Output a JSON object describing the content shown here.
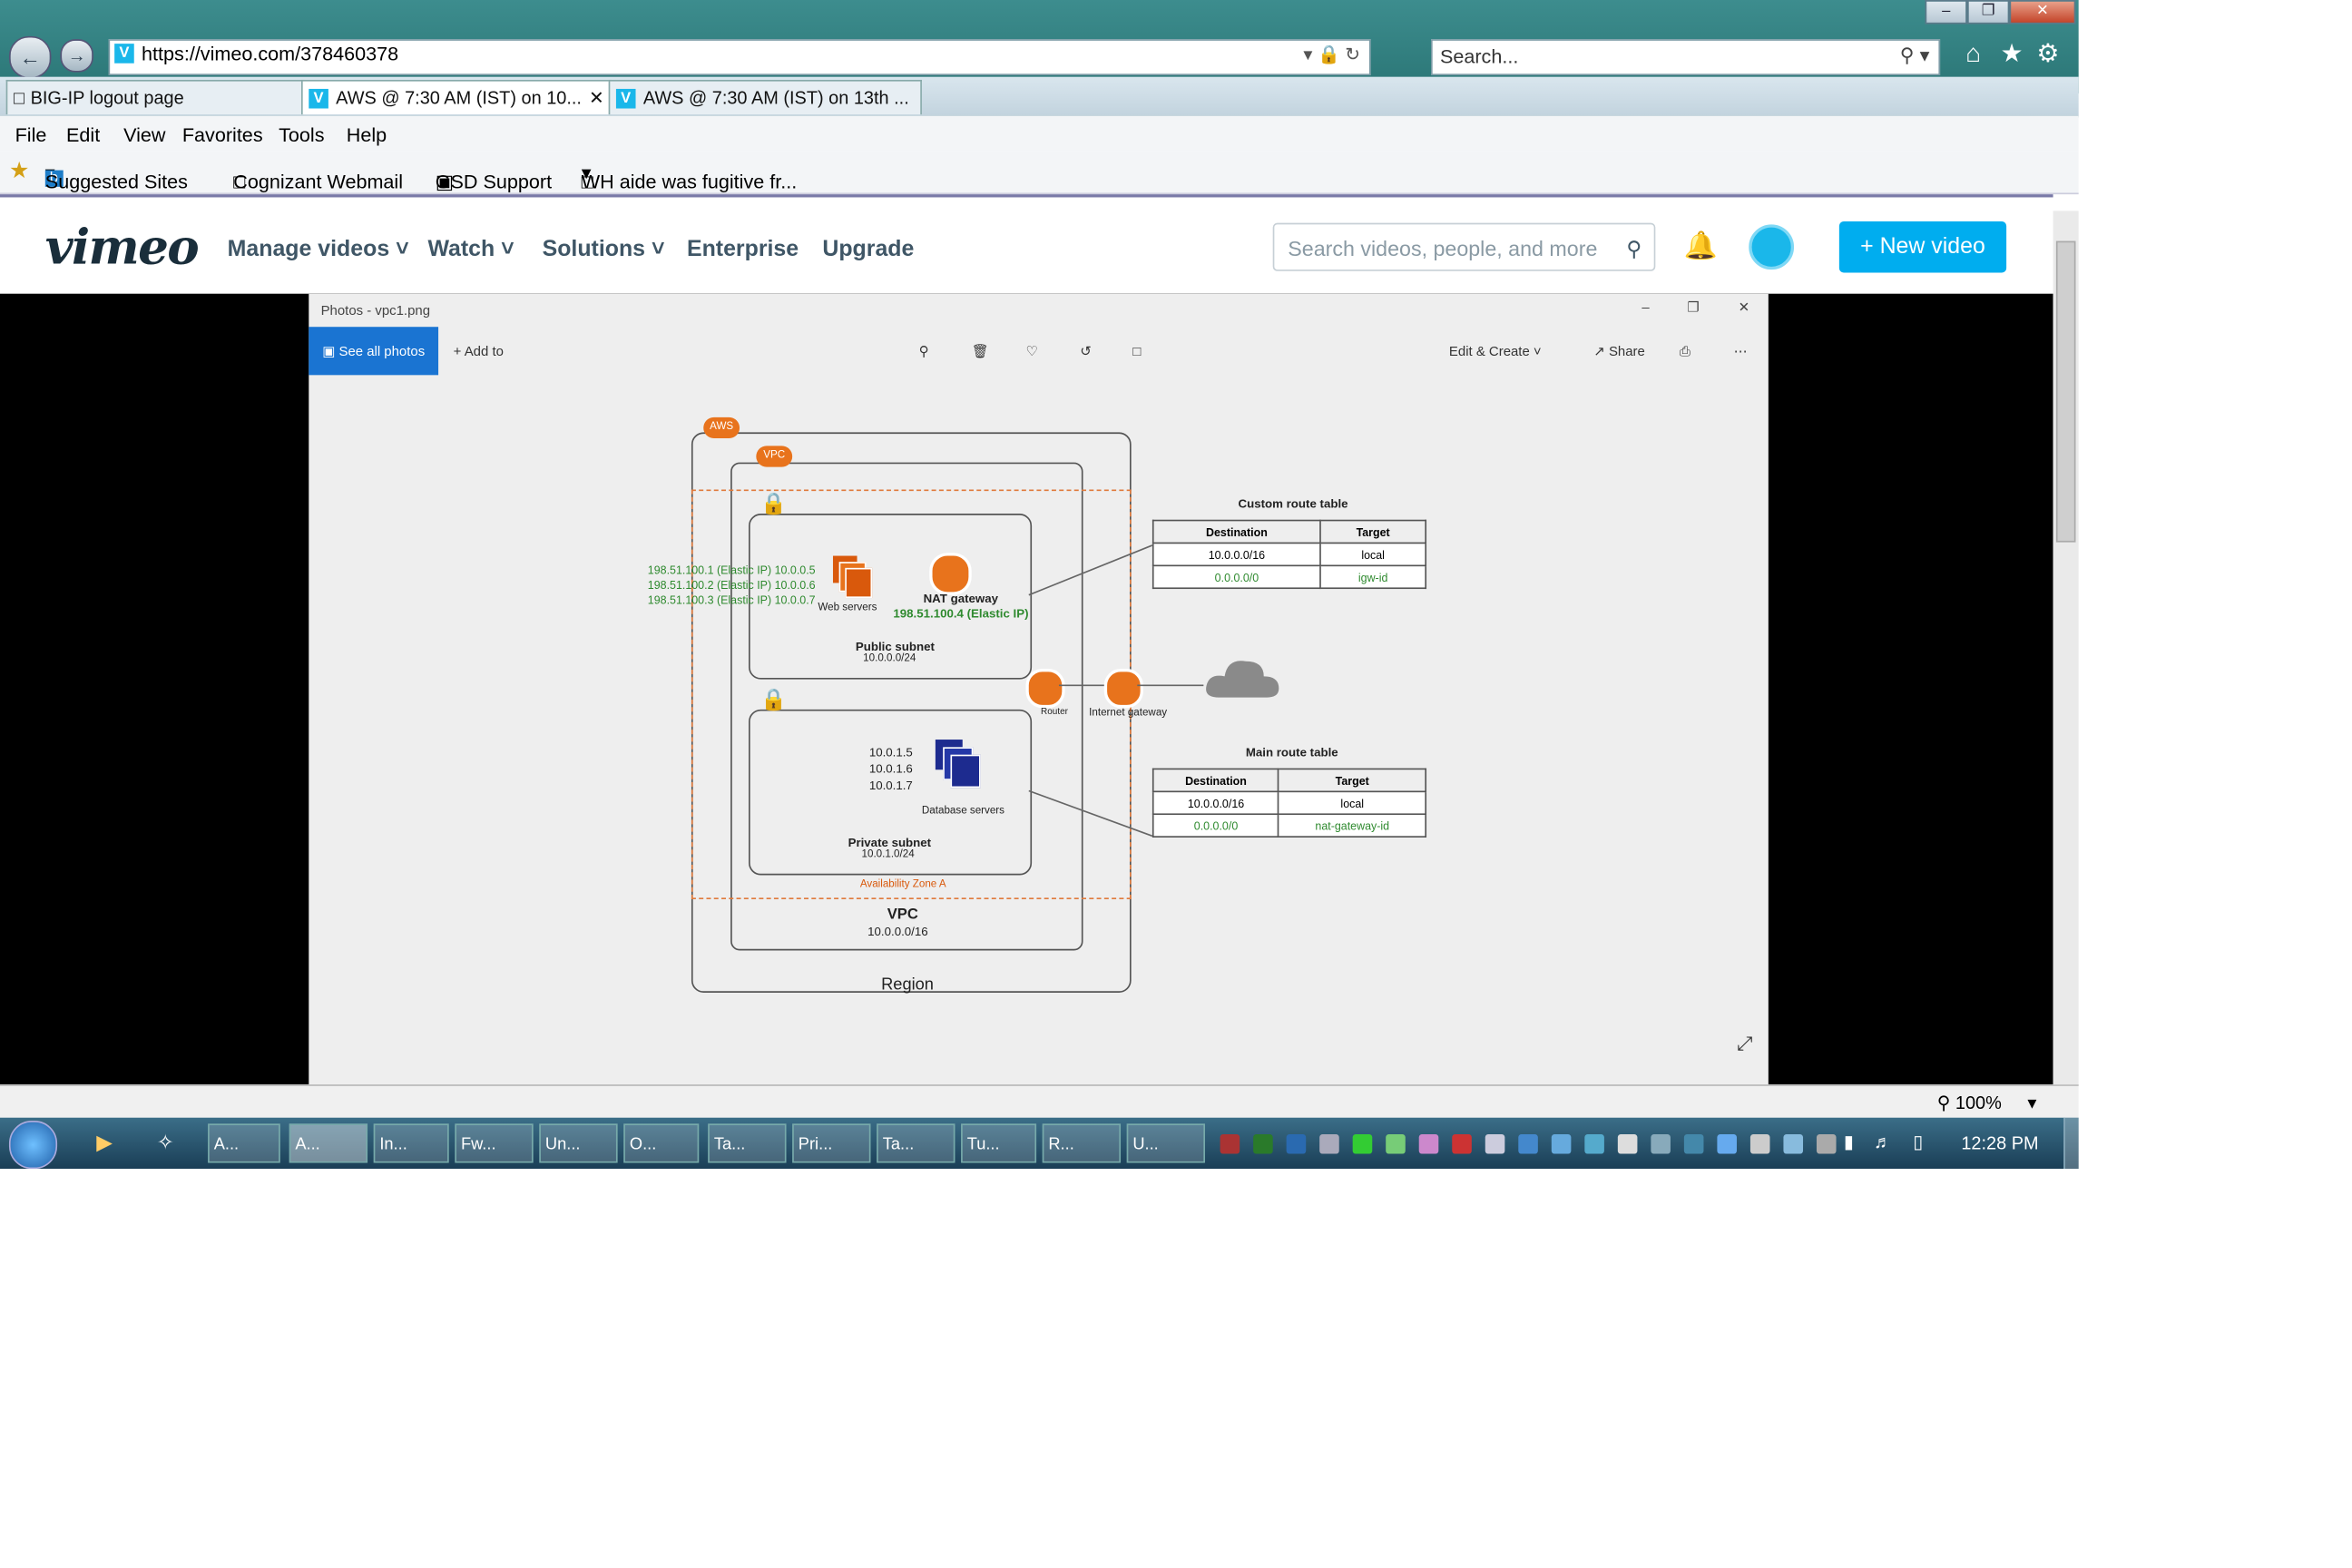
{
  "browser": {
    "url": "https://vimeo.com/378460378",
    "search_placeholder": "Search...",
    "tabs": [
      {
        "label": "BIG-IP logout page"
      },
      {
        "label": "AWS @ 7:30 AM (IST) on 10..."
      },
      {
        "label": "AWS @ 7:30 AM (IST) on 13th ..."
      }
    ],
    "menu": [
      "File",
      "Edit",
      "View",
      "Favorites",
      "Tools",
      "Help"
    ],
    "favorites": [
      "Suggested Sites",
      "Cognizant Webmail",
      "GSD Support",
      "WH aide was fugitive fr..."
    ],
    "zoom": "100%"
  },
  "vimeo": {
    "logo": "vimeo",
    "nav": [
      "Manage videos",
      "Watch",
      "Solutions",
      "Enterprise",
      "Upgrade"
    ],
    "search_placeholder": "Search videos, people, and more",
    "new_video": "New video"
  },
  "photos_app": {
    "title": "Photos - vpc1.png",
    "see_all": "See all photos",
    "add_to": "Add to",
    "edit_create": "Edit & Create",
    "share": "Share"
  },
  "diagram": {
    "aws_badge": "AWS",
    "vpc_badge": "VPC",
    "elastic_ips": [
      "198.51.100.1 (Elastic IP) 10.0.0.5",
      "198.51.100.2 (Elastic IP) 10.0.0.6",
      "198.51.100.3 (Elastic IP) 10.0.0.7"
    ],
    "web_servers": "Web servers",
    "nat_gateway": "NAT gateway",
    "nat_ip": "198.51.100.4 (Elastic IP)",
    "public_subnet": "Public subnet",
    "public_cidr": "10.0.0.0/24",
    "db_ips": [
      "10.0.1.5",
      "10.0.1.6",
      "10.0.1.7"
    ],
    "database_servers": "Database servers",
    "private_subnet": "Private  subnet",
    "private_cidr": "10.0.1.0/24",
    "az": "Availability Zone A",
    "vpc_label": "VPC",
    "vpc_cidr": "10.0.0.0/16",
    "region": "Region",
    "router": "Router",
    "igw": "Internet gateway",
    "custom_rt": {
      "title": "Custom route table",
      "headers": [
        "Destination",
        "Target"
      ],
      "rows": [
        [
          "10.0.0.0/16",
          "local"
        ],
        [
          "0.0.0.0/0",
          "igw-id"
        ]
      ]
    },
    "main_rt": {
      "title": "Main route table",
      "headers": [
        "Destination",
        "Target"
      ],
      "rows": [
        [
          "10.0.0.0/16",
          "local"
        ],
        [
          "0.0.0.0/0",
          "nat-gateway-id"
        ]
      ]
    }
  },
  "taskbar": {
    "items": [
      "A...",
      "A...",
      "In...",
      "Fw...",
      "Un...",
      "O...",
      "Ta...",
      "Pri...",
      "Ta...",
      "Tu...",
      "R...",
      "U..."
    ],
    "clock": "12:28 PM"
  }
}
